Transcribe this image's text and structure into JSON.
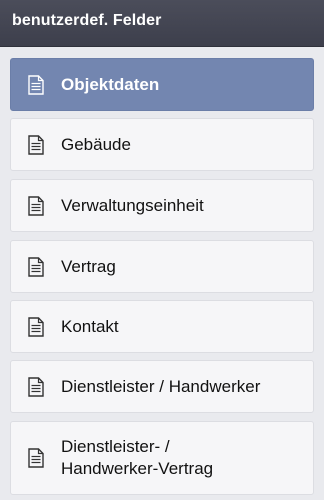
{
  "header": {
    "title": "benutzerdef. Felder"
  },
  "items": [
    {
      "label": "Objektdaten",
      "icon": "document-icon",
      "active": true
    },
    {
      "label": "Gebäude",
      "icon": "document-icon",
      "active": false
    },
    {
      "label": "Verwaltungseinheit",
      "icon": "document-icon",
      "active": false
    },
    {
      "label": "Vertrag",
      "icon": "document-icon",
      "active": false
    },
    {
      "label": "Kontakt",
      "icon": "document-icon",
      "active": false
    },
    {
      "label": "Dienstleister / Handwerker",
      "icon": "document-icon",
      "active": false
    },
    {
      "label": "Dienstleister- / Handwerker-Vertrag",
      "icon": "document-icon",
      "active": false
    }
  ],
  "colors": {
    "header_bg": "#42444f",
    "active_bg": "#7386b0",
    "item_bg": "#f6f6f8",
    "page_bg": "#e9eaee"
  }
}
